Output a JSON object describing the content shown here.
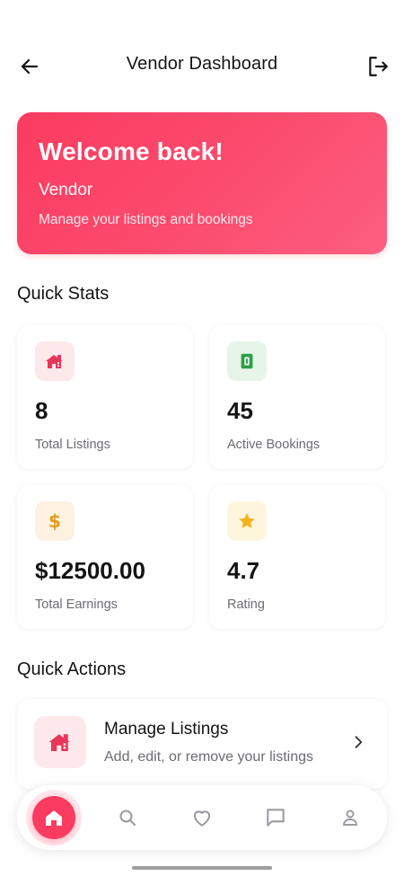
{
  "header": {
    "title": "Vendor Dashboard",
    "back_icon": "arrow-left-icon",
    "logout_icon": "logout-icon"
  },
  "banner": {
    "title": "Welcome back!",
    "name": "Vendor",
    "subtitle": "Manage your listings and bookings"
  },
  "quick_stats": {
    "title": "Quick Stats",
    "items": [
      {
        "value": "8",
        "label": "Total Listings",
        "icon": "listings-icon",
        "color": "#e8365a",
        "bg": "#fde8ec"
      },
      {
        "value": "45",
        "label": "Active Bookings",
        "icon": "booking-icon",
        "color": "#2e9e48",
        "bg": "#e6f4e9"
      },
      {
        "value": "$12500.00",
        "label": "Total Earnings",
        "icon": "dollar-icon",
        "color": "#e19a1a",
        "bg": "#fdf1e0"
      },
      {
        "value": "4.7",
        "label": "Rating",
        "icon": "star-icon",
        "color": "#f2b41c",
        "bg": "#fdf6dc"
      }
    ]
  },
  "quick_actions": {
    "title": "Quick Actions",
    "items": [
      {
        "title": "Manage Listings",
        "subtitle": "Add, edit, or remove your listings",
        "icon": "listings-icon"
      }
    ]
  },
  "bottom_nav": {
    "items": [
      "home-icon",
      "search-icon",
      "heart-icon",
      "chat-icon",
      "profile-icon"
    ],
    "active": "home-icon",
    "accent": "#fb3b60"
  }
}
